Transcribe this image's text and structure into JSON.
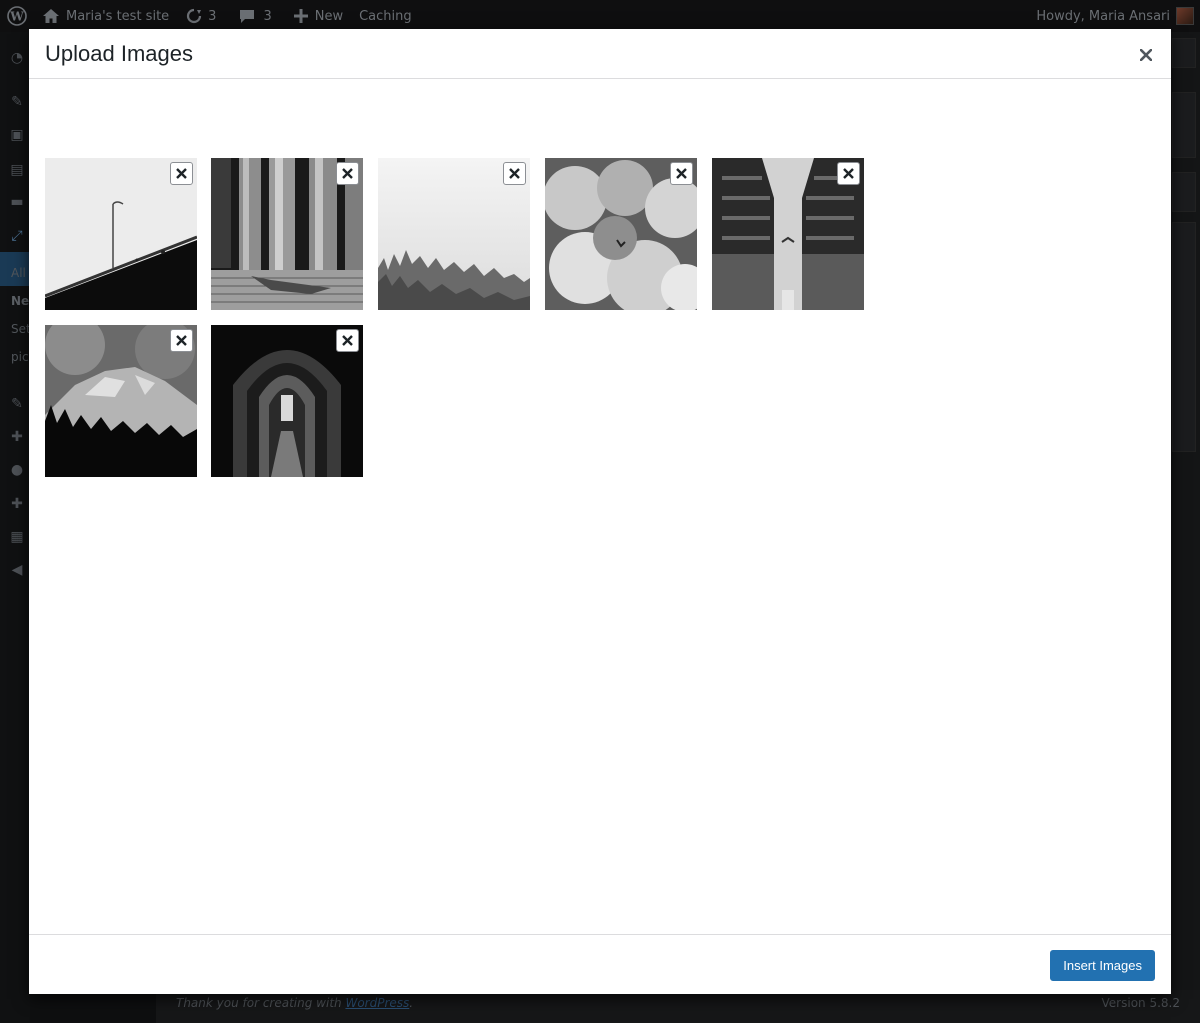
{
  "admin_bar": {
    "site_name": "Maria's test site",
    "updates_count": "3",
    "comments_count": "3",
    "new_label": "New",
    "caching_label": "Caching",
    "greeting": "Howdy, Maria Ansari"
  },
  "sidebar": {
    "items": [
      "All",
      "Ne",
      "Set",
      "pic"
    ]
  },
  "footer": {
    "thanks_prefix": "Thank you for creating with ",
    "thanks_link": "WordPress",
    "thanks_suffix": ".",
    "version": "Version 5.8.2"
  },
  "modal": {
    "title": "Upload Images",
    "close_icon": "close-icon",
    "insert_button_label": "Insert Images",
    "images": [
      {
        "subject": "bridge-lamp"
      },
      {
        "subject": "columns-pigeons"
      },
      {
        "subject": "foggy-forest"
      },
      {
        "subject": "clouds-bird"
      },
      {
        "subject": "buildings-sky"
      },
      {
        "subject": "mountain-trees"
      },
      {
        "subject": "gothic-arches"
      }
    ]
  },
  "colors": {
    "primary_button": "#2271b1",
    "overlay": "#0e0f10",
    "modal_bg": "#ffffff"
  }
}
